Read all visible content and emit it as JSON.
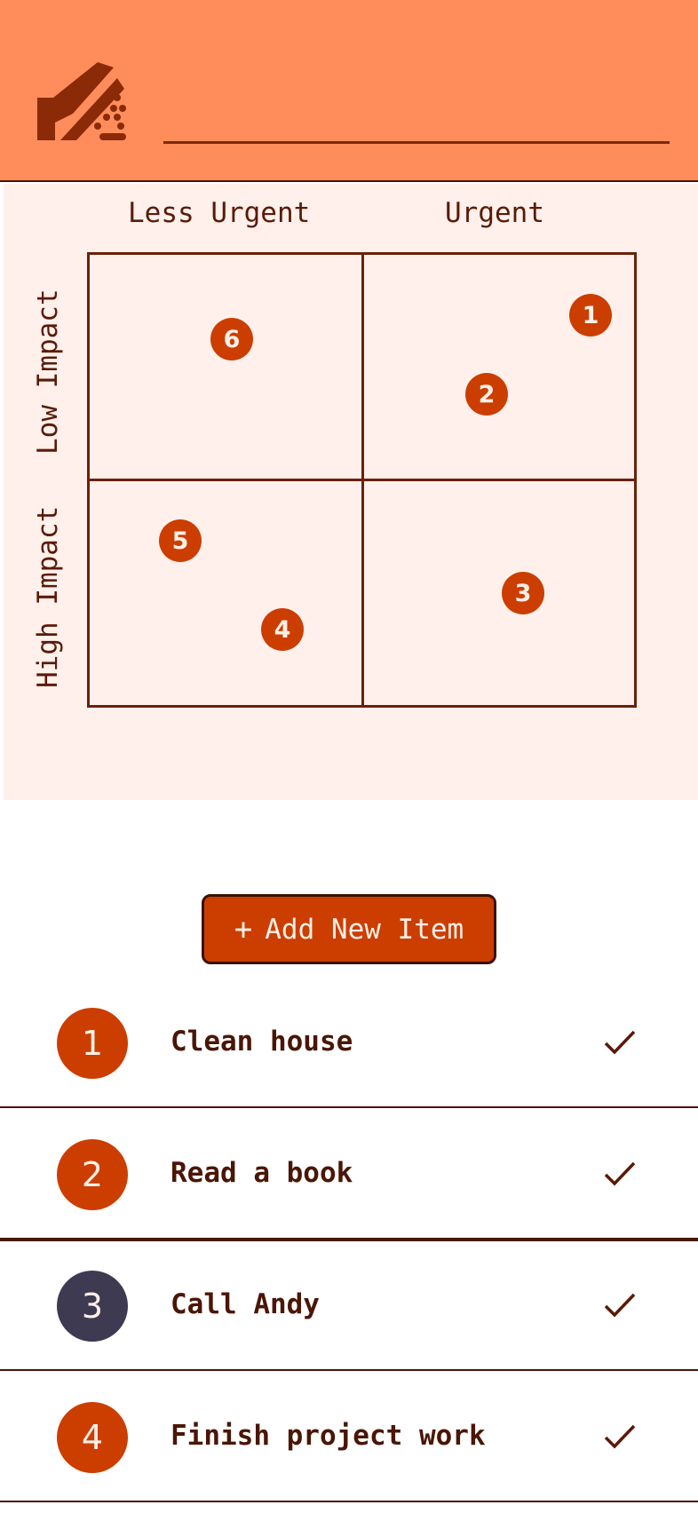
{
  "header": {
    "title_value": "",
    "title_placeholder": ""
  },
  "matrix": {
    "col_labels": [
      "Less Urgent",
      "Urgent"
    ],
    "row_labels": [
      "Low Impact",
      "High Impact"
    ],
    "markers": [
      "1",
      "2",
      "3",
      "4",
      "5",
      "6"
    ]
  },
  "add_button": {
    "label": "Add New Item",
    "icon": "plus-icon"
  },
  "items": [
    {
      "num": "1",
      "text": "Clean house",
      "status_icon": "check-icon"
    },
    {
      "num": "2",
      "text": "Read a book",
      "status_icon": "check-icon"
    },
    {
      "num": "3",
      "text": "Call Andy",
      "status_icon": "check-icon"
    },
    {
      "num": "4",
      "text": "Finish project work",
      "status_icon": "check-icon"
    }
  ],
  "colors": {
    "header_bg": "#ff8d5c",
    "accent": "#cc3d00",
    "dark_marker": "#3e3a52",
    "matrix_bg": "#fff0eb",
    "text_dark": "#4a1606"
  }
}
